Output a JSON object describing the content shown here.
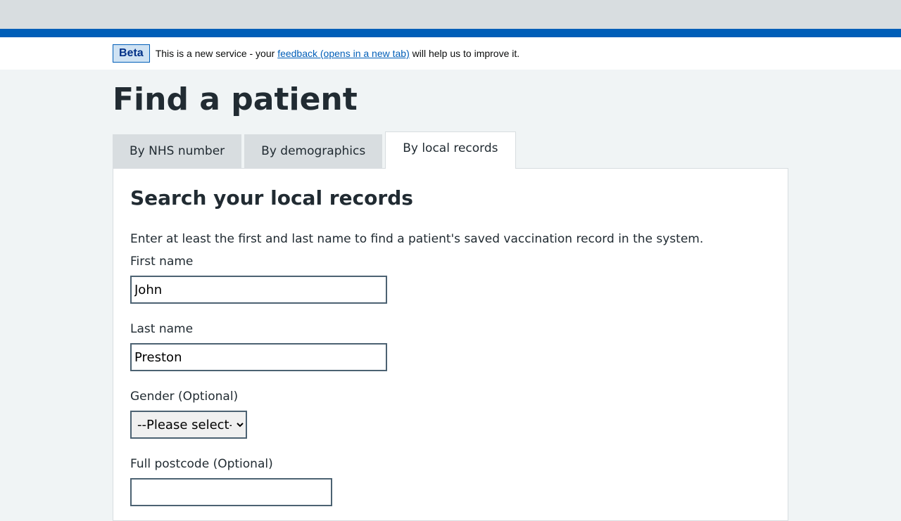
{
  "beta_banner": {
    "tag": "Beta",
    "text_before": "This is a new service - your ",
    "link_text": "feedback (opens in a new tab)",
    "text_after": " will help us to improve it."
  },
  "page_title": "Find a patient",
  "tabs": [
    {
      "label": "By NHS number",
      "active": false
    },
    {
      "label": "By demographics",
      "active": false
    },
    {
      "label": "By local records",
      "active": true
    }
  ],
  "panel": {
    "heading": "Search your local records",
    "hint": "Enter at least the first and last name to find a patient's saved vaccination record in the system."
  },
  "form": {
    "first_name": {
      "label": "First name",
      "value": "John"
    },
    "last_name": {
      "label": "Last name",
      "value": "Preston"
    },
    "gender": {
      "label": "Gender (Optional)",
      "selected": "--Please select--"
    },
    "postcode": {
      "label": "Full postcode (Optional)",
      "value": ""
    }
  },
  "colors": {
    "brand_blue": "#005eb8",
    "page_background": "#f0f4f5",
    "text": "#212b32"
  }
}
